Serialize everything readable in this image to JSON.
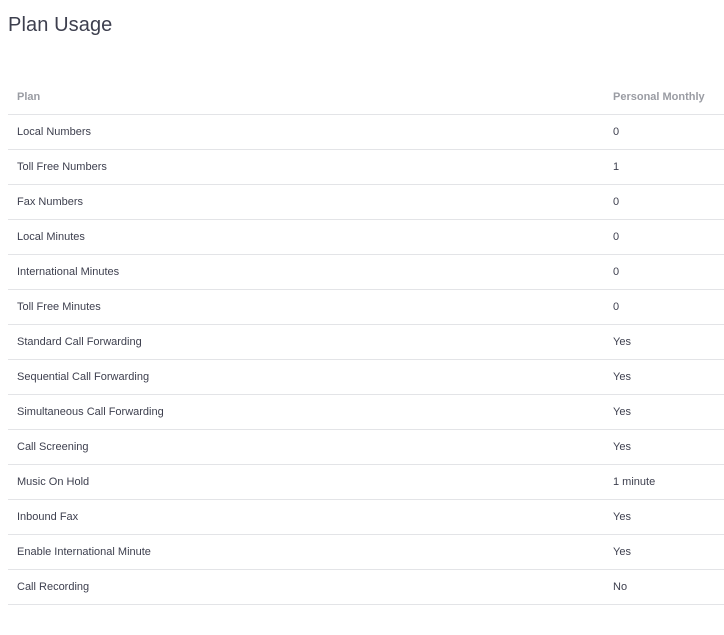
{
  "page_title": "Plan Usage",
  "table": {
    "headers": {
      "plan": "Plan",
      "value": "Personal Monthly"
    },
    "rows": [
      {
        "feature": "Local Numbers",
        "value": "0"
      },
      {
        "feature": "Toll Free Numbers",
        "value": "1"
      },
      {
        "feature": "Fax Numbers",
        "value": "0"
      },
      {
        "feature": "Local Minutes",
        "value": "0"
      },
      {
        "feature": "International Minutes",
        "value": "0"
      },
      {
        "feature": "Toll Free Minutes",
        "value": "0"
      },
      {
        "feature": "Standard Call Forwarding",
        "value": "Yes"
      },
      {
        "feature": "Sequential Call Forwarding",
        "value": "Yes"
      },
      {
        "feature": "Simultaneous Call Forwarding",
        "value": "Yes"
      },
      {
        "feature": "Call Screening",
        "value": "Yes"
      },
      {
        "feature": "Music On Hold",
        "value": "1 minute"
      },
      {
        "feature": "Inbound Fax",
        "value": "Yes"
      },
      {
        "feature": "Enable International Minute",
        "value": "Yes"
      },
      {
        "feature": "Call Recording",
        "value": "No"
      }
    ]
  }
}
